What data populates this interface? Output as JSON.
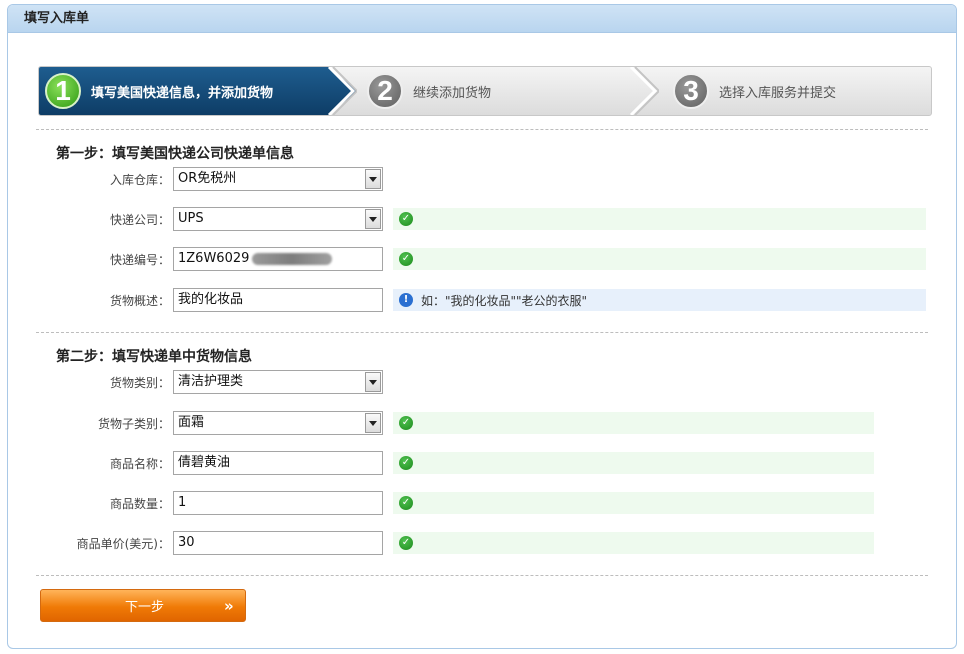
{
  "header": {
    "title": "填写入库单"
  },
  "steps": [
    {
      "number": "1",
      "label": "填写美国快递信息，并添加货物"
    },
    {
      "number": "2",
      "label": "继续添加货物"
    },
    {
      "number": "3",
      "label": "选择入库服务并提交"
    }
  ],
  "section1": {
    "title": "第一步：填写美国快递公司快递单信息",
    "warehouse_label": "入库仓库：",
    "warehouse_value": "OR免税州",
    "courier_label": "快递公司：",
    "courier_value": "UPS",
    "tracking_label": "快递编号：",
    "tracking_value": "1Z6W6029",
    "summary_label": "货物概述：",
    "summary_value": "我的化妆品",
    "summary_hint": "如：\"我的化妆品\"\"老公的衣服\""
  },
  "section2": {
    "title": "第二步：填写快递单中货物信息",
    "category_label": "货物类别：",
    "category_value": "清洁护理类",
    "subcategory_label": "货物子类别：",
    "subcategory_value": "面霜",
    "name_label": "商品名称：",
    "name_value": "倩碧黄油",
    "qty_label": "商品数量：",
    "qty_value": "1",
    "price_label": "商品单价(美元)：",
    "price_value": "30"
  },
  "actions": {
    "next_label": "下一步",
    "next_arrows": "»"
  },
  "colors": {
    "accent": "#0e3d66",
    "button": "#f07a06",
    "ok": "#1d8a1d",
    "info": "#2a6fd1"
  }
}
